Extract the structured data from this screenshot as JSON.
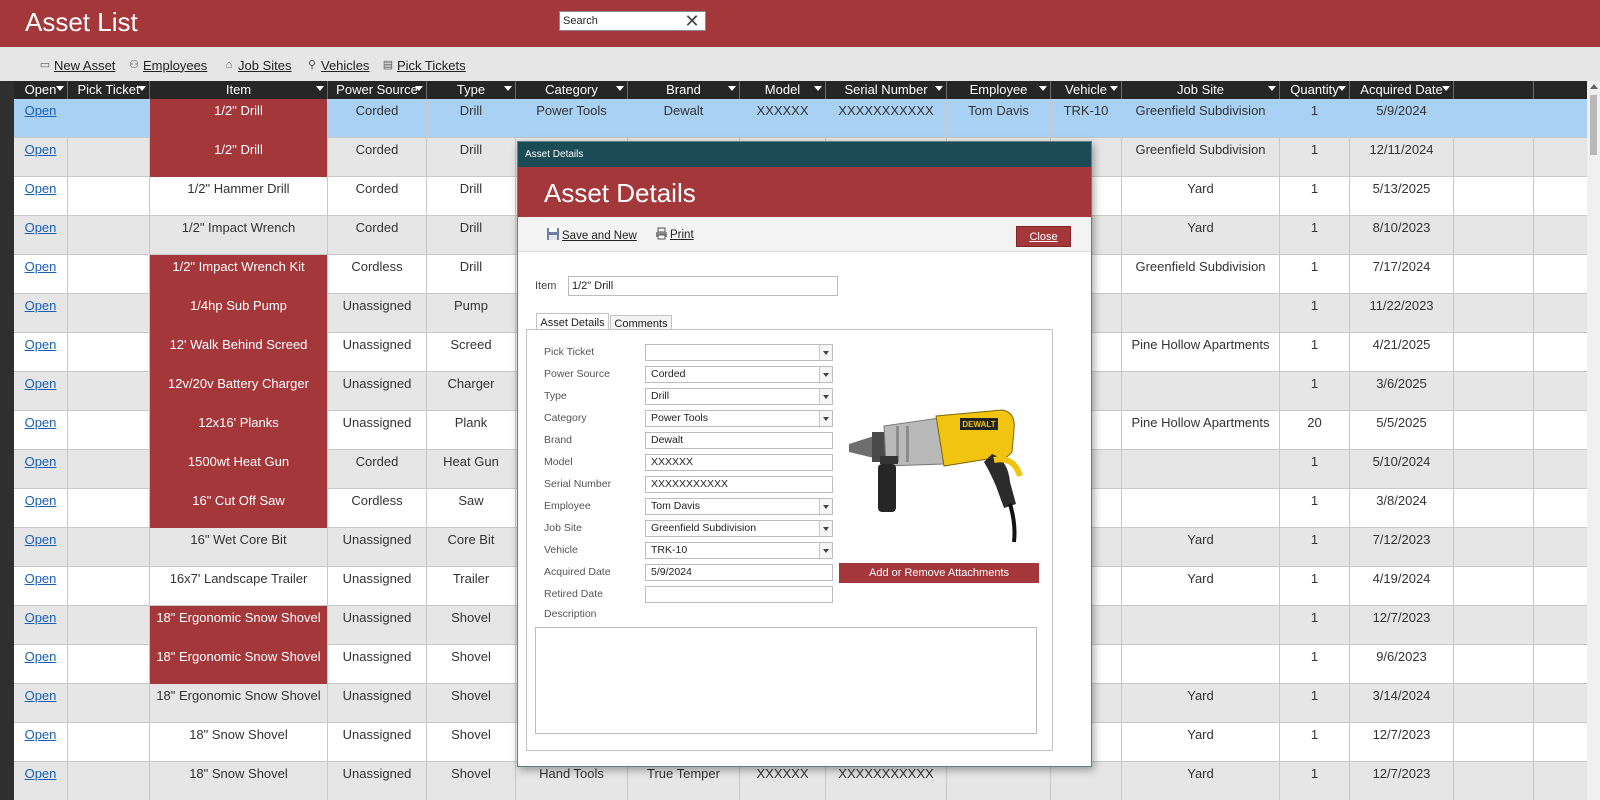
{
  "app": {
    "title": "Asset List"
  },
  "search": {
    "value": "Search"
  },
  "toolbar": {
    "new_asset": "New Asset",
    "employees": "Employees",
    "job_sites": "Job Sites",
    "vehicles": "Vehicles",
    "pick_tickets": "Pick Tickets"
  },
  "table": {
    "columns": [
      "Open",
      "Pick Ticket",
      "Item",
      "Power Source",
      "Type",
      "Category",
      "Brand",
      "Model",
      "Serial Number",
      "Employee",
      "Vehicle",
      "Job Site",
      "Quantity",
      "Acquired Date"
    ],
    "rows": [
      {
        "open": "Open",
        "pick_ticket": "",
        "item": "1/2\" Drill",
        "power_source": "Corded",
        "type": "Drill",
        "category": "Power Tools",
        "brand": "Dewalt",
        "model": "XXXXXX",
        "serial": "XXXXXXXXXXX",
        "employee": "Tom Davis",
        "vehicle": "TRK-10",
        "job_site": "Greenfield Subdivision",
        "quantity": "1",
        "acquired": "5/9/2024",
        "highlight": true,
        "selected": true
      },
      {
        "open": "Open",
        "pick_ticket": "",
        "item": "1/2\" Drill",
        "power_source": "Corded",
        "type": "Drill",
        "category": "",
        "brand": "",
        "model": "",
        "serial": "",
        "employee": "",
        "vehicle": "",
        "job_site": "Greenfield Subdivision",
        "quantity": "1",
        "acquired": "12/11/2024",
        "highlight": true,
        "selected": false
      },
      {
        "open": "Open",
        "pick_ticket": "",
        "item": "1/2\" Hammer Drill",
        "power_source": "Corded",
        "type": "Drill",
        "category": "",
        "brand": "",
        "model": "",
        "serial": "",
        "employee": "",
        "vehicle": "",
        "job_site": "Yard",
        "quantity": "1",
        "acquired": "5/13/2025",
        "highlight": false,
        "selected": false
      },
      {
        "open": "Open",
        "pick_ticket": "",
        "item": "1/2\" Impact Wrench",
        "power_source": "Corded",
        "type": "Drill",
        "category": "",
        "brand": "",
        "model": "",
        "serial": "",
        "employee": "",
        "vehicle": "",
        "job_site": "Yard",
        "quantity": "1",
        "acquired": "8/10/2023",
        "highlight": false,
        "selected": false
      },
      {
        "open": "Open",
        "pick_ticket": "",
        "item": "1/2\" Impact Wrench Kit",
        "power_source": "Cordless",
        "type": "Drill",
        "category": "",
        "brand": "",
        "model": "",
        "serial": "",
        "employee": "",
        "vehicle": "",
        "job_site": "Greenfield Subdivision",
        "quantity": "1",
        "acquired": "7/17/2024",
        "highlight": true,
        "selected": false
      },
      {
        "open": "Open",
        "pick_ticket": "",
        "item": "1/4hp Sub Pump",
        "power_source": "Unassigned",
        "type": "Pump",
        "category": "",
        "brand": "",
        "model": "",
        "serial": "",
        "employee": "",
        "vehicle": "",
        "job_site": "",
        "quantity": "1",
        "acquired": "11/22/2023",
        "highlight": true,
        "selected": false
      },
      {
        "open": "Open",
        "pick_ticket": "",
        "item": "12' Walk Behind Screed",
        "power_source": "Unassigned",
        "type": "Screed",
        "category": "",
        "brand": "",
        "model": "",
        "serial": "",
        "employee": "",
        "vehicle": "",
        "job_site": "Pine Hollow Apartments",
        "quantity": "1",
        "acquired": "4/21/2025",
        "highlight": true,
        "selected": false
      },
      {
        "open": "Open",
        "pick_ticket": "",
        "item": "12v/20v Battery Charger",
        "power_source": "Unassigned",
        "type": "Charger",
        "category": "",
        "brand": "",
        "model": "",
        "serial": "",
        "employee": "",
        "vehicle": "",
        "job_site": "",
        "quantity": "1",
        "acquired": "3/6/2025",
        "highlight": true,
        "selected": false
      },
      {
        "open": "Open",
        "pick_ticket": "",
        "item": "12x16' Planks",
        "power_source": "Unassigned",
        "type": "Plank",
        "category": "",
        "brand": "",
        "model": "",
        "serial": "",
        "employee": "",
        "vehicle": "",
        "job_site": "Pine Hollow Apartments",
        "quantity": "20",
        "acquired": "5/5/2025",
        "highlight": true,
        "selected": false
      },
      {
        "open": "Open",
        "pick_ticket": "",
        "item": "1500wt Heat Gun",
        "power_source": "Corded",
        "type": "Heat Gun",
        "category": "",
        "brand": "",
        "model": "",
        "serial": "",
        "employee": "",
        "vehicle": "",
        "job_site": "",
        "quantity": "1",
        "acquired": "5/10/2024",
        "highlight": true,
        "selected": false
      },
      {
        "open": "Open",
        "pick_ticket": "",
        "item": "16\" Cut Off Saw",
        "power_source": "Cordless",
        "type": "Saw",
        "category": "",
        "brand": "",
        "model": "",
        "serial": "",
        "employee": "",
        "vehicle": "",
        "job_site": "",
        "quantity": "1",
        "acquired": "3/8/2024",
        "highlight": true,
        "selected": false
      },
      {
        "open": "Open",
        "pick_ticket": "",
        "item": "16\" Wet Core Bit",
        "power_source": "Unassigned",
        "type": "Core Bit",
        "category": "",
        "brand": "",
        "model": "",
        "serial": "",
        "employee": "",
        "vehicle": "",
        "job_site": "Yard",
        "quantity": "1",
        "acquired": "7/12/2023",
        "highlight": false,
        "selected": false
      },
      {
        "open": "Open",
        "pick_ticket": "",
        "item": "16x7' Landscape Trailer",
        "power_source": "Unassigned",
        "type": "Trailer",
        "category": "",
        "brand": "",
        "model": "",
        "serial": "",
        "employee": "",
        "vehicle": "",
        "job_site": "Yard",
        "quantity": "1",
        "acquired": "4/19/2024",
        "highlight": false,
        "selected": false
      },
      {
        "open": "Open",
        "pick_ticket": "",
        "item": "18\" Ergonomic Snow Shovel",
        "power_source": "Unassigned",
        "type": "Shovel",
        "category": "",
        "brand": "",
        "model": "",
        "serial": "",
        "employee": "",
        "vehicle": "",
        "job_site": "",
        "quantity": "1",
        "acquired": "12/7/2023",
        "highlight": true,
        "selected": false
      },
      {
        "open": "Open",
        "pick_ticket": "",
        "item": "18\" Ergonomic Snow Shovel",
        "power_source": "Unassigned",
        "type": "Shovel",
        "category": "",
        "brand": "",
        "model": "",
        "serial": "",
        "employee": "",
        "vehicle": "",
        "job_site": "",
        "quantity": "1",
        "acquired": "9/6/2023",
        "highlight": true,
        "selected": false
      },
      {
        "open": "Open",
        "pick_ticket": "",
        "item": "18\" Ergonomic Snow Shovel",
        "power_source": "Unassigned",
        "type": "Shovel",
        "category": "",
        "brand": "",
        "model": "",
        "serial": "",
        "employee": "",
        "vehicle": "",
        "job_site": "Yard",
        "quantity": "1",
        "acquired": "3/14/2024",
        "highlight": false,
        "selected": false
      },
      {
        "open": "Open",
        "pick_ticket": "",
        "item": "18\" Snow Shovel",
        "power_source": "Unassigned",
        "type": "Shovel",
        "category": "",
        "brand": "",
        "model": "",
        "serial": "",
        "employee": "",
        "vehicle": "",
        "job_site": "Yard",
        "quantity": "1",
        "acquired": "12/7/2023",
        "highlight": false,
        "selected": false
      },
      {
        "open": "Open",
        "pick_ticket": "",
        "item": "18\" Snow Shovel",
        "power_source": "Unassigned",
        "type": "Shovel",
        "category": "Hand Tools",
        "brand": "True Temper",
        "model": "XXXXXX",
        "serial": "XXXXXXXXXXX",
        "employee": "",
        "vehicle": "",
        "job_site": "Yard",
        "quantity": "1",
        "acquired": "12/7/2023",
        "highlight": false,
        "selected": false
      }
    ]
  },
  "dialog": {
    "window_title": "Asset Details",
    "heading": "Asset Details",
    "save_and_new": "Save and New",
    "print": "Print",
    "close": "Close",
    "item_label": "Item",
    "item_value": "1/2\" Drill",
    "tabs": [
      "Asset Details",
      "Comments"
    ],
    "fields": [
      {
        "label": "Pick Ticket",
        "value": "",
        "dropdown": true
      },
      {
        "label": "Power Source",
        "value": "Corded",
        "dropdown": true
      },
      {
        "label": "Type",
        "value": "Drill",
        "dropdown": true
      },
      {
        "label": "Category",
        "value": "Power Tools",
        "dropdown": true
      },
      {
        "label": "Brand",
        "value": "Dewalt",
        "dropdown": false
      },
      {
        "label": "Model",
        "value": "XXXXXX",
        "dropdown": false
      },
      {
        "label": "Serial Number",
        "value": "XXXXXXXXXXX",
        "dropdown": false
      },
      {
        "label": "Employee",
        "value": "Tom Davis",
        "dropdown": true
      },
      {
        "label": "Job Site",
        "value": "Greenfield Subdivision",
        "dropdown": true
      },
      {
        "label": "Vehicle",
        "value": "TRK-10",
        "dropdown": true
      },
      {
        "label": "Acquired Date",
        "value": "5/9/2024",
        "dropdown": false
      },
      {
        "label": "Retired Date",
        "value": "",
        "dropdown": false
      }
    ],
    "description_label": "Description",
    "attachments_button": "Add or Remove Attachments",
    "image_brand_text": "DEWALT"
  },
  "colors": {
    "brand_red": "#a4373a",
    "dialog_titlebar": "#1b4b55",
    "selected_row": "#a9d1f3",
    "header_dark": "#262626",
    "link_blue": "#1a5fb4"
  },
  "icons": {
    "new_asset": "new-record-icon",
    "employees": "people-icon",
    "job_sites": "sites-icon",
    "vehicles": "vehicle-icon",
    "pick_tickets": "ticket-icon",
    "save_and_new": "save-icon",
    "print": "printer-icon"
  }
}
